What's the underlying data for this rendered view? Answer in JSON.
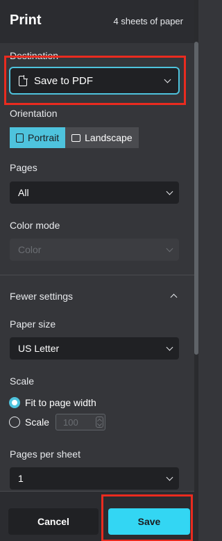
{
  "header": {
    "title": "Print",
    "sheets": "4 sheets of paper"
  },
  "destination": {
    "label": "Destination",
    "value": "Save to PDF"
  },
  "orientation": {
    "label": "Orientation",
    "portrait": "Portrait",
    "landscape": "Landscape",
    "selected": "Portrait"
  },
  "pages": {
    "label": "Pages",
    "value": "All"
  },
  "color_mode": {
    "label": "Color mode",
    "value": "Color"
  },
  "more_settings": {
    "label": "Fewer settings"
  },
  "paper_size": {
    "label": "Paper size",
    "value": "US Letter"
  },
  "scale": {
    "label": "Scale",
    "fit_label": "Fit to page width",
    "custom_label": "Scale",
    "custom_value": "100",
    "selected": "Fit to page width"
  },
  "pages_per_sheet": {
    "label": "Pages per sheet",
    "value": "1"
  },
  "footer": {
    "cancel": "Cancel",
    "save": "Save"
  },
  "colors": {
    "accent": "#33d6f3",
    "background": "#35363a",
    "highlight": "#ea2b1f"
  }
}
